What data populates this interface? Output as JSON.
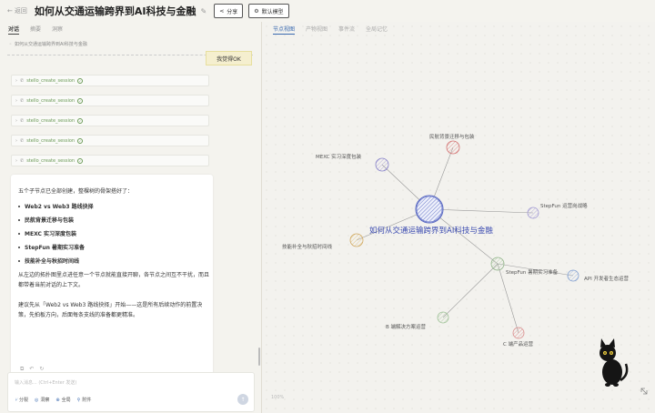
{
  "topbar": {
    "back_label": "返回",
    "title": "如何从交通运输跨界到AI科技与金融",
    "share_label": "分享",
    "model_label": "默认模型"
  },
  "left": {
    "tabs": [
      "对话",
      "摘要",
      "洞察"
    ],
    "breadcrumb": "如何从交通运输跨界到AI科技与金融",
    "user_message": "我觉得OK",
    "tool_calls": [
      "stello_create_session",
      "stello_create_session",
      "stello_create_session",
      "stello_create_session",
      "stello_create_session"
    ],
    "reply": {
      "intro": "五个子节点已全部创建，整棵树的骨架搭好了：",
      "items": [
        "Web2 vs Web3 路线抉择",
        "民航背景迁移与包装",
        "MEXC 实习深度包装",
        "StepFun 暑期实习准备",
        "技能补全与秋招时间线"
      ],
      "para1": "从左边的拓扑图里点进任意一个节点就能直接开聊，各节点之间互不干扰，而且都带着当前对话的上下文。",
      "para2": "建议先从「Web2 vs Web3 路线抉择」开始——这是所有后续动作的前置决策，先拍板方向，后面每条支线的准备都更精准。"
    },
    "input": {
      "placeholder": "输入消息... (Ctrl+Enter 发送)",
      "actions": [
        "分裂",
        "洞察",
        "全局",
        "附件"
      ]
    }
  },
  "right": {
    "tabs": [
      "节点视图",
      "产物视图",
      "事件流",
      "全局记忆"
    ],
    "zoom": "100%"
  },
  "graph": {
    "root": "如何从交通运输跨界到AI科技与金融",
    "nodes": [
      "民航背景迁移与包装",
      "MEXC 实习深度包装",
      "StepFun 暑期实习准备",
      "技能补全与秋招时间线",
      "StepFun 运营岗战略",
      "StepFun 暑期实习准备",
      "API 开发者生态运营",
      "B 端解决方案运营",
      "C 端产品运营"
    ]
  },
  "colors": {
    "accent": "#3a6ab0",
    "tool_green": "#6a9a56",
    "bubble": "#f5efcf"
  }
}
